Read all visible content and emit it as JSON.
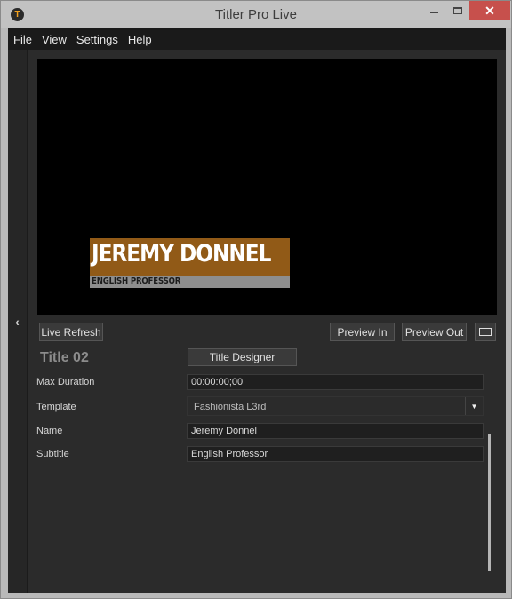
{
  "window": {
    "title": "Titler Pro Live",
    "close_glyph": "✕"
  },
  "menu": [
    "File",
    "View",
    "Settings",
    "Help"
  ],
  "sidebar": {
    "collapse_glyph": "‹"
  },
  "preview": {
    "lower_third_name": "JEREMY DONNEL",
    "lower_third_subtitle": "ENGLISH PROFESSOR"
  },
  "toolbar": {
    "live_refresh": "Live Refresh",
    "preview_in": "Preview In",
    "preview_out": "Preview Out"
  },
  "title_panel": {
    "title_name": "Title 02",
    "title_designer": "Title Designer",
    "fields": {
      "max_duration": {
        "label": "Max Duration",
        "value": "00:00:00;00"
      },
      "template": {
        "label": "Template",
        "value": "Fashionista L3rd"
      },
      "name": {
        "label": "Name",
        "value": "Jeremy Donnel"
      },
      "subtitle": {
        "label": "Subtitle",
        "value": "English Professor"
      }
    }
  },
  "colors": {
    "name_bar": "#915a17",
    "subtitle_bar": "#8e8e8e",
    "close_button": "#c7504c"
  }
}
